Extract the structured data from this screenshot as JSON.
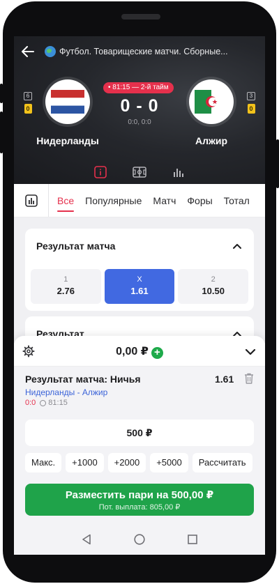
{
  "header": {
    "league": "Футбол. Товарищеские матчи. Сборные...",
    "time_status": "81:15 — 2-й тайм",
    "score": "0 - 0",
    "sub_score": "0:0, 0:0",
    "home": {
      "name": "Нидерланды",
      "lineup": "6",
      "cards": "0"
    },
    "away": {
      "name": "Алжир",
      "lineup": "3",
      "cards": "0"
    }
  },
  "market_tabs": [
    "Все",
    "Популярные",
    "Матч",
    "Форы",
    "Тотал"
  ],
  "markets": [
    {
      "title": "Результат матча",
      "odds": [
        {
          "label": "1",
          "value": "2.76"
        },
        {
          "label": "X",
          "value": "1.61"
        },
        {
          "label": "2",
          "value": "10.50"
        }
      ]
    },
    {
      "title": "Результат"
    }
  ],
  "coupon": {
    "balance": "0,00 ₽",
    "bet_title": "Результат матча: Ничья",
    "bet_odd": "1.61",
    "teams": "Нидерланды - Алжир",
    "live_score": "0:0",
    "live_time": "81:15",
    "stake": "500 ₽",
    "quick_buttons": [
      "Макс.",
      "+1000",
      "+2000",
      "+5000",
      "Рассчитать"
    ],
    "place_label": "Разместить пари на 500,00 ₽",
    "payout_label": "Пот. выплата: 805,00 ₽"
  },
  "colors": {
    "accent_red": "#e5304c",
    "selected_blue": "#4169e1",
    "action_green": "#1fa34a",
    "card_yellow": "#f2c21b"
  }
}
